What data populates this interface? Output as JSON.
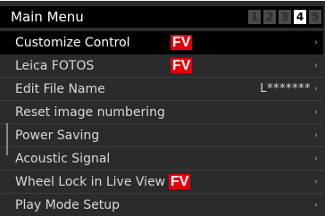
{
  "header": {
    "title": "Main Menu",
    "pages": [
      "1",
      "2",
      "3",
      "4",
      "5"
    ],
    "active_page": "4"
  },
  "menu": {
    "items": [
      {
        "label": "Customize Control",
        "badge": "FV",
        "value": "",
        "selected": true
      },
      {
        "label": "Leica FOTOS",
        "badge": "FV",
        "value": "",
        "selected": false
      },
      {
        "label": "Edit File Name",
        "badge": "",
        "value": "L*******",
        "selected": false
      },
      {
        "label": "Reset image numbering",
        "badge": "",
        "value": "",
        "selected": false
      },
      {
        "label": "Power Saving",
        "badge": "",
        "value": "",
        "selected": false
      },
      {
        "label": "Acoustic Signal",
        "badge": "",
        "value": "",
        "selected": false
      },
      {
        "label": "Wheel Lock in Live View",
        "badge": "FV",
        "value": "",
        "selected": false
      },
      {
        "label": "Play Mode Setup",
        "badge": "",
        "value": "",
        "selected": false
      }
    ],
    "chevron": "›"
  },
  "colors": {
    "badge": "#e3000b",
    "selected_bg": "#000000",
    "menu_bg": "#2b2b2b"
  },
  "icons": [
    "chevron-right-icon"
  ]
}
